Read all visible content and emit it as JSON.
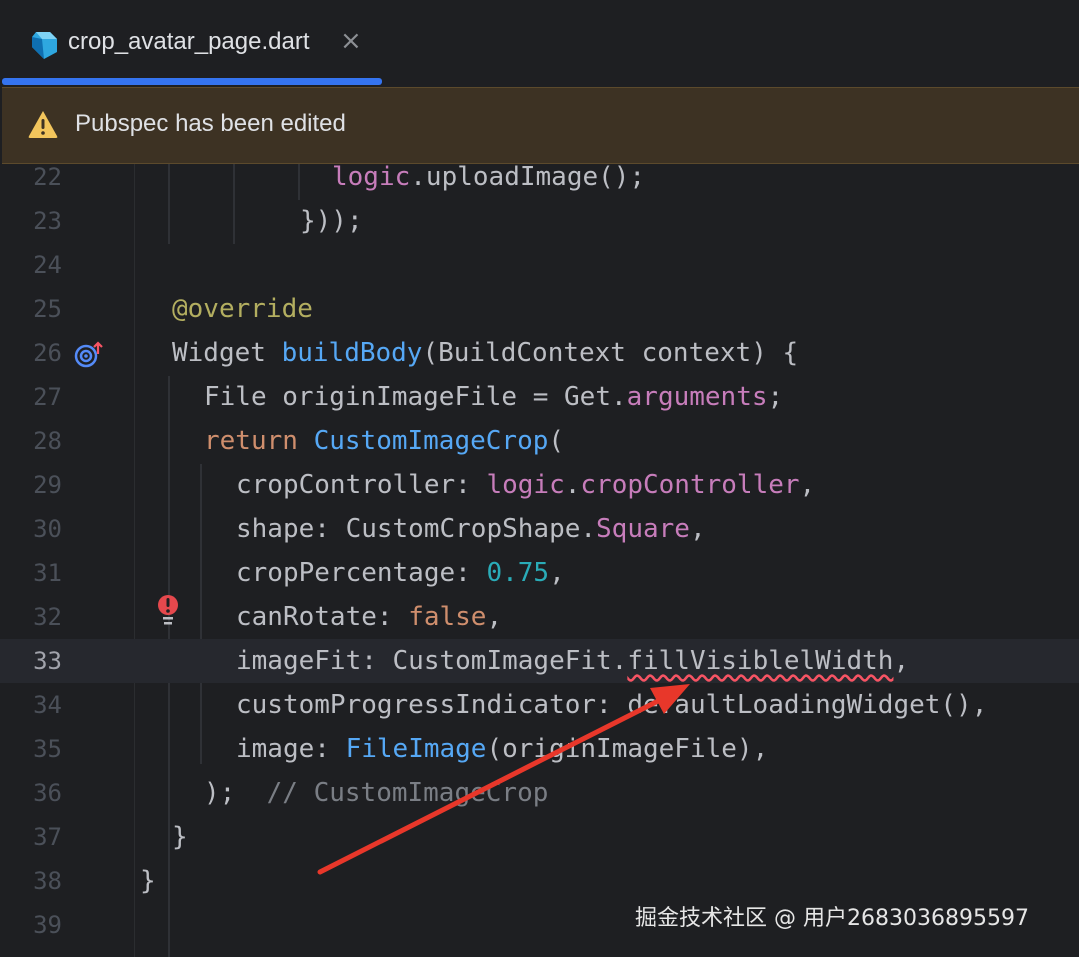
{
  "tab": {
    "title": "crop_avatar_page.dart",
    "close_glyph": "×",
    "icon": "dart-icon"
  },
  "banner": {
    "message": "Pubspec has been edited",
    "icon": "warning-icon"
  },
  "lines": [
    {
      "n": "22"
    },
    {
      "n": "23"
    },
    {
      "n": "24"
    },
    {
      "n": "25"
    },
    {
      "n": "26"
    },
    {
      "n": "27"
    },
    {
      "n": "28"
    },
    {
      "n": "29"
    },
    {
      "n": "30"
    },
    {
      "n": "31"
    },
    {
      "n": "32"
    },
    {
      "n": "33"
    },
    {
      "n": "34"
    },
    {
      "n": "35"
    },
    {
      "n": "36"
    },
    {
      "n": "37"
    },
    {
      "n": "38"
    },
    {
      "n": "39"
    }
  ],
  "code": {
    "l22": {
      "logic": "logic",
      "rest": ".uploadImage();"
    },
    "l23": {
      "text": "}));"
    },
    "l25": {
      "ann": "@override"
    },
    "l26": {
      "type": "Widget ",
      "fn": "buildBody",
      "rest": "(BuildContext context) {"
    },
    "l27": {
      "a": "File originImageFile = Get.",
      "prop": "arguments",
      "b": ";"
    },
    "l28": {
      "kw": "return ",
      "fn": "CustomImageCrop",
      "b": "("
    },
    "l29": {
      "a": "cropController: ",
      "p1": "logic",
      "dot": ".",
      "p2": "cropController",
      "b": ","
    },
    "l30": {
      "a": "shape: CustomCropShape.",
      "prop": "Square",
      "b": ","
    },
    "l31": {
      "a": "cropPercentage: ",
      "num": "0.75",
      "b": ","
    },
    "l32": {
      "a": "canRotate: ",
      "kw": "false",
      "b": ","
    },
    "l33": {
      "a": "imageFit: CustomImageFit.",
      "err": "fillVisiblelWidth",
      "b": ","
    },
    "l34": {
      "text": "customProgressIndicator: defaultLoadingWidget(),"
    },
    "l35": {
      "a": "image: ",
      "fn": "FileImage",
      "b": "(originImageFile),"
    },
    "l36": {
      "a": ");  ",
      "cmt": "// CustomImageCrop"
    },
    "l37": {
      "text": "}"
    },
    "l38": {
      "text": "}"
    }
  },
  "gutter_icons": [
    "override-icon",
    "error-bulb-icon"
  ],
  "watermark": "掘金技术社区 @ 用户2683036895597",
  "colors": {
    "background": "#1e1f22",
    "tab_accent": "#3574f0",
    "banner_bg": "#3d3223",
    "keyword": "#cf8e6d",
    "function": "#56a8f5",
    "property": "#c77dbb",
    "number": "#2aacb8",
    "annotation": "#b3ae60",
    "comment": "#7a7e85",
    "error_underline": "#f75464",
    "arrow": "#e8372a"
  }
}
